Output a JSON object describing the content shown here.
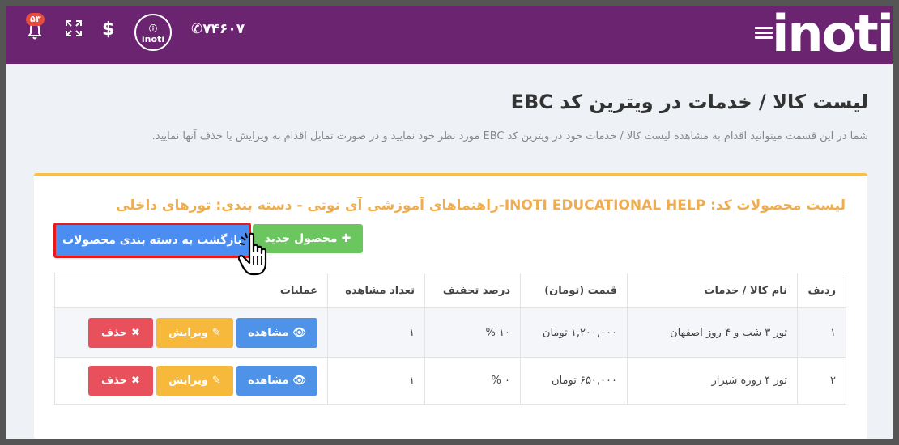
{
  "header": {
    "logo": "inoti",
    "phone": "۷۴۶۰۷",
    "circle_logo": "inoti",
    "notification_count": "۵۳",
    "colors": {
      "bar": "#6a2470"
    }
  },
  "page": {
    "title": "لیست کالا / خدمات در ویترین کد EBC",
    "description": "شما در این قسمت میتوانید اقدام به مشاهده لیست کالا / خدمات خود در ویترین کد EBC مورد نظر خود نمایید و در صورت تمایل اقدام به ویرایش یا حذف آنها نمایید."
  },
  "panel": {
    "title": "لیست محصولات کد: INOTI EDUCATIONAL HELP-راهنماهای آموزشی آی نوتی - دسته بندی: تورهای داخلی",
    "new_button": "محصول جدید",
    "back_button": "بازگشت به دسته بندی محصولات"
  },
  "table": {
    "headers": [
      "ردیف",
      "نام کالا / خدمات",
      "قیمت (تومان)",
      "درصد تخفیف",
      "تعداد مشاهده",
      "عملیات"
    ],
    "rows": [
      {
        "index": "۱",
        "name": "تور ۳ شب و ۴ روز اصفهان",
        "price": "۱,۲۰۰,۰۰۰ تومان",
        "discount": "۱۰ %",
        "views": "۱"
      },
      {
        "index": "۲",
        "name": "تور ۴ روزه شیراز",
        "price": "۶۵۰,۰۰۰ تومان",
        "discount": "۰ %",
        "views": "۱"
      }
    ],
    "actions": {
      "view": "مشاهده",
      "edit": "ویرایش",
      "delete": "حذف"
    }
  }
}
